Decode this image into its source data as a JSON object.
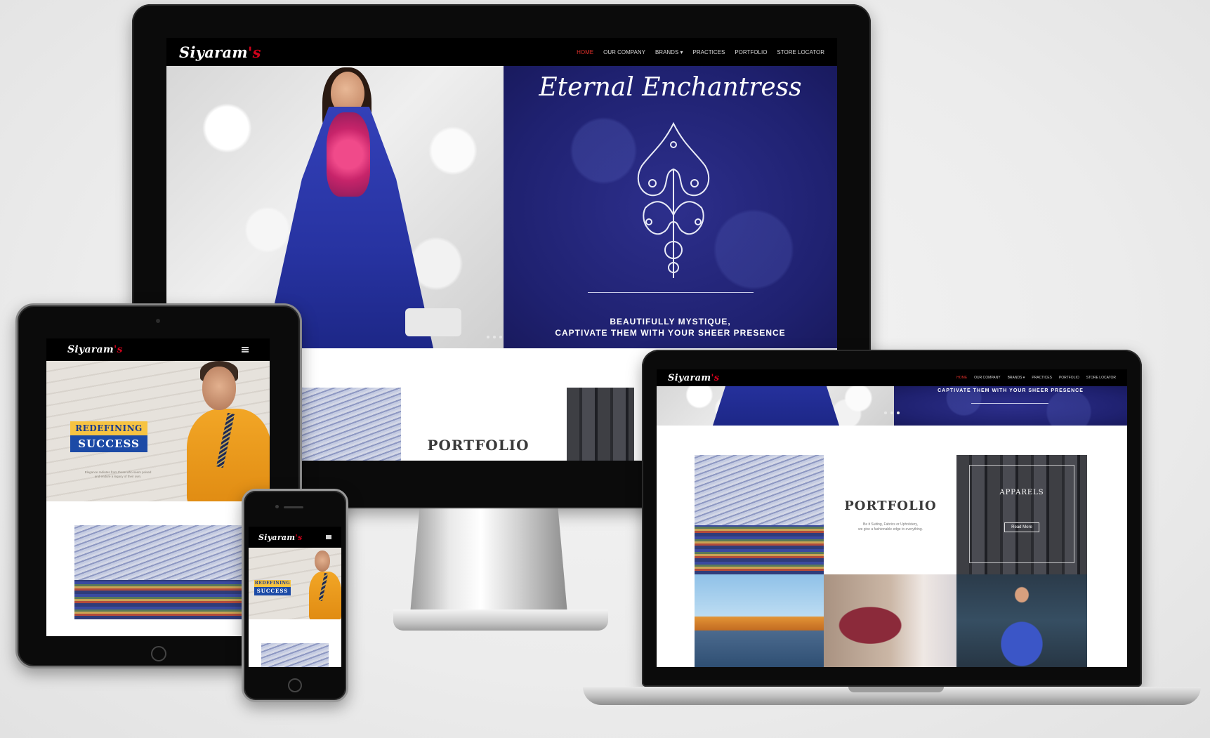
{
  "site": {
    "logo": "Siyaram",
    "logo_apos": "'s"
  },
  "nav": {
    "items": [
      {
        "label": "Home",
        "active": true
      },
      {
        "label": "Our Company",
        "active": false
      },
      {
        "label": "Brands ▾",
        "active": false
      },
      {
        "label": "Practices",
        "active": false
      },
      {
        "label": "Portfolio",
        "active": false
      },
      {
        "label": "Store Locator",
        "active": false
      }
    ]
  },
  "hero": {
    "script_title": "Eternal Enchantress",
    "tagline_line1": "Beautifully Mystique,",
    "tagline_line2": "Captivate them with your sheer presence"
  },
  "portfolio": {
    "title": "PORTFOLIO",
    "text_line1": "Be it Suiting, Fabrics or Upholstery,",
    "text_line2": "we give a fashionable edge to everything.",
    "apparels_label": "APPARELS",
    "read_more": "Read More"
  },
  "promo": {
    "badge_top": "REDEFINING",
    "badge_bottom": "SUCCESS",
    "text_line1": "Elegance radiates from those who seem poised",
    "text_line2": "and endure a legacy of their own."
  },
  "colors": {
    "brand_red": "#d0021b",
    "nav_active": "#e0302a",
    "hero_blue": "#1f2170",
    "navbar_bg": "#000000"
  }
}
